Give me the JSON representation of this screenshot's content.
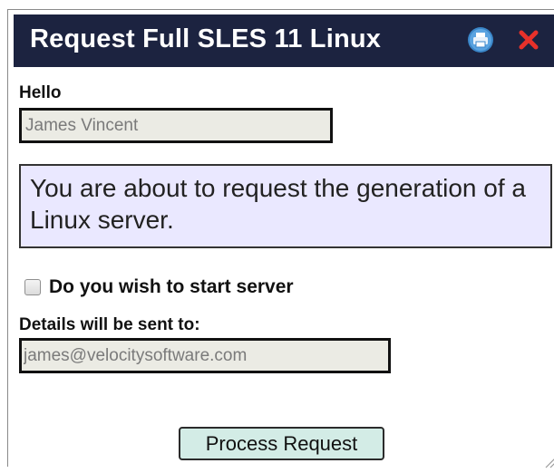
{
  "dialog": {
    "title": "Request Full SLES 11 Linux",
    "print_icon": "print-icon",
    "close_icon": "close-icon"
  },
  "form": {
    "hello_label": "Hello",
    "name_value": "James Vincent",
    "info_message": "You are about to request the generation of a Linux server.",
    "start_server_label": "Do you wish to start server",
    "start_server_checked": false,
    "details_label": "Details will be sent to:",
    "email_value": "james@velocitysoftware.com",
    "submit_label": "Process Request"
  },
  "colors": {
    "title_bar": "#1c2340",
    "info_box_bg": "#eae8ff",
    "field_bg": "#ebebe4",
    "button_bg": "#d3ece6",
    "close_icon": "#e8312a",
    "print_icon": "#3a86c8"
  }
}
